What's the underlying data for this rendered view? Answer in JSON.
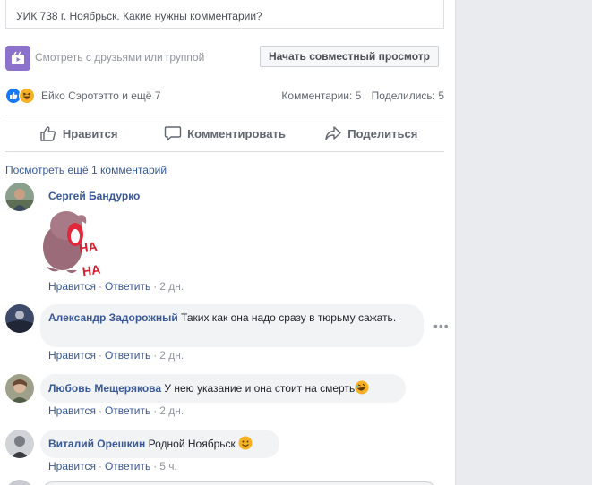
{
  "video": {
    "caption": "УИК 738 г. Ноябрьск. Какие нужны комментарии?"
  },
  "watch_party": {
    "label": "Смотреть с друзьями или группой",
    "button": "Начать совместный просмотр",
    "icon": "watch-party-icon"
  },
  "reactions": {
    "names": "Ейко Сэротэтто и ещё 7",
    "comments": "Комментарии: 5",
    "shares": "Поделились: 5",
    "icons": [
      "like-reaction-icon",
      "haha-reaction-icon"
    ]
  },
  "actions": {
    "like": "Нравится",
    "comment": "Комментировать",
    "share": "Поделиться"
  },
  "comments": {
    "view_more": "Посмотреть ещё 1 комментарий",
    "items": [
      {
        "author": "Сергей Бандурко",
        "text": "",
        "sticker": "НА НА",
        "like": "Нравится",
        "reply": "Ответить",
        "time": "2 дн."
      },
      {
        "author": "Александр Задорожный",
        "text": "Таких как она надо сразу в тюрьму сажать.",
        "like": "Нравится",
        "reply": "Ответить",
        "time": "2 дн."
      },
      {
        "author": "Любовь Мещерякова",
        "text": "У нею указание и она стоит на смерть",
        "like": "Нравится",
        "reply": "Ответить",
        "time": "2 дн."
      },
      {
        "author": "Виталий Орешкин",
        "text": "Родной Ноябрьск",
        "like": "Нравится",
        "reply": "Ответить",
        "time": "5 ч."
      }
    ]
  },
  "colors": {
    "link": "#385898",
    "accent_like": "#1877f2",
    "bubble": "#f2f3f5",
    "page_bg": "#e9ebee"
  }
}
